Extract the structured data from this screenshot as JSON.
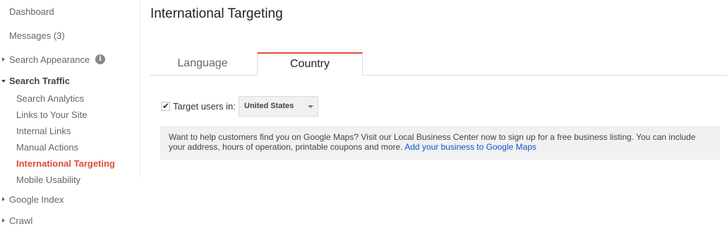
{
  "sidebar": {
    "dashboard": "Dashboard",
    "messages": "Messages (3)",
    "search_appearance": "Search Appearance",
    "info_icon_glyph": "i",
    "search_traffic": "Search Traffic",
    "search_traffic_items": [
      "Search Analytics",
      "Links to Your Site",
      "Internal Links",
      "Manual Actions",
      "International Targeting",
      "Mobile Usability"
    ],
    "google_index": "Google Index",
    "crawl": "Crawl",
    "active_item": "International Targeting"
  },
  "main": {
    "title": "International Targeting",
    "tabs": [
      {
        "label": "Language",
        "active": false
      },
      {
        "label": "Country",
        "active": true
      }
    ],
    "target_label": "Target users in:",
    "target_checked": true,
    "country_select": "United States",
    "info_text": "Want to help customers find you on Google Maps? Visit our Local Business Center now to sign up for a free business listing. You can include your address, hours of operation, printable coupons and more.",
    "info_link": "Add your business to Google Maps"
  },
  "colors": {
    "accent": "#dd4b39",
    "link": "#1155cc"
  },
  "icons": {
    "check": "✔",
    "expand": "triangle-right",
    "collapse": "triangle-down"
  }
}
